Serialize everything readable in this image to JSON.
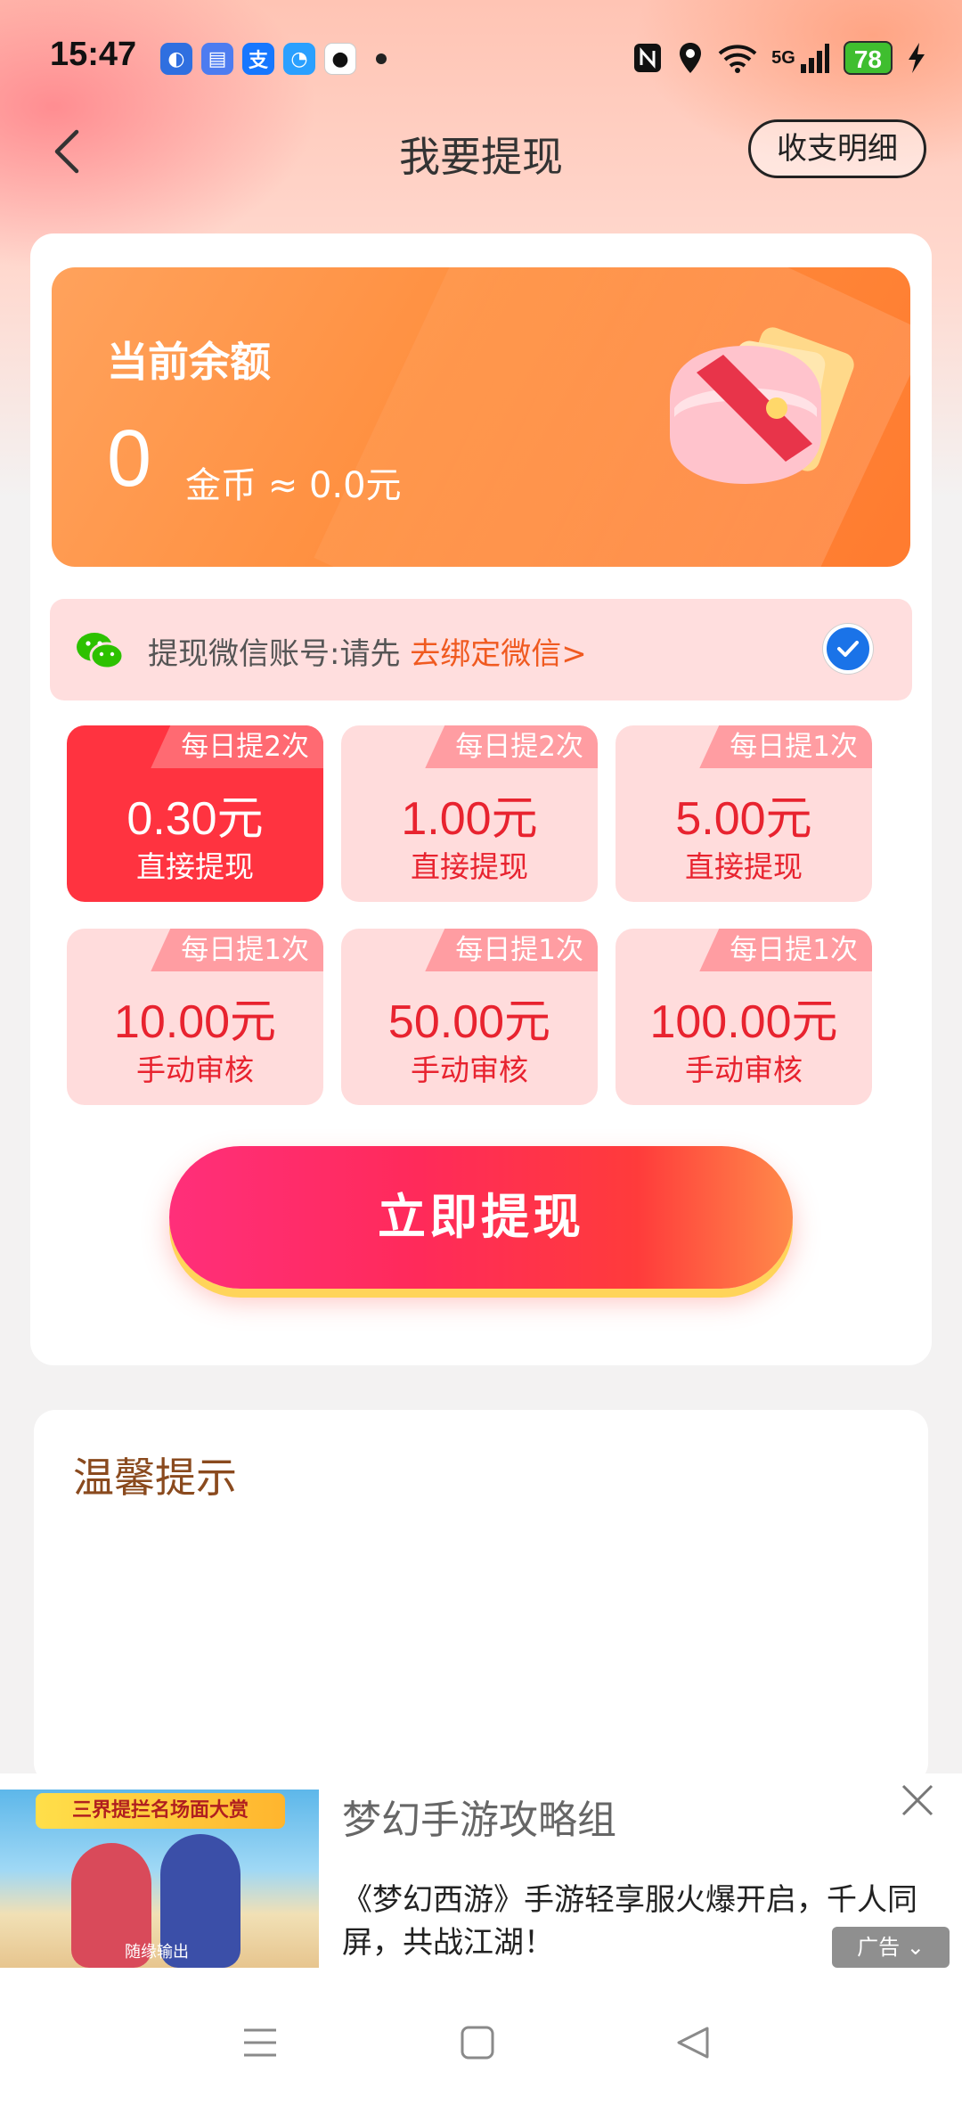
{
  "status_bar": {
    "time": "15:47",
    "network": "5G",
    "battery": "78",
    "notification_icons": [
      "app-blue-icon",
      "message-icon",
      "alipay-icon",
      "browser-icon",
      "qq-icon"
    ],
    "system_icons": [
      "nfc-icon",
      "location-icon",
      "wifi-icon",
      "signal-icon",
      "battery-icon",
      "charging-icon"
    ]
  },
  "header": {
    "title": "我要提现",
    "details_button": "收支明细"
  },
  "balance": {
    "label": "当前余额",
    "value": "0",
    "unit_text": "金币 ≈ 0.0元"
  },
  "wechat": {
    "prefix": "提现微信账号:请先",
    "link": "去绑定微信>"
  },
  "options": [
    {
      "tag": "每日提2次",
      "amount": "0.30元",
      "desc": "直接提现",
      "selected": true
    },
    {
      "tag": "每日提2次",
      "amount": "1.00元",
      "desc": "直接提现",
      "selected": false
    },
    {
      "tag": "每日提1次",
      "amount": "5.00元",
      "desc": "直接提现",
      "selected": false
    },
    {
      "tag": "每日提1次",
      "amount": "10.00元",
      "desc": "手动审核",
      "selected": false
    },
    {
      "tag": "每日提1次",
      "amount": "50.00元",
      "desc": "手动审核",
      "selected": false
    },
    {
      "tag": "每日提1次",
      "amount": "100.00元",
      "desc": "手动审核",
      "selected": false
    }
  ],
  "withdraw_button": "立即提现",
  "tips": {
    "title": "温馨提示"
  },
  "ad": {
    "image_banner": "三界提拦名场面大赏",
    "image_caption": "随缘输出",
    "title": "梦幻手游攻略组",
    "body": "《梦幻西游》手游轻享服火爆开启，千人同屏，共战江湖！",
    "badge": "广告"
  },
  "colors": {
    "accent_red": "#ff3340",
    "balance_orange": "#ff8f3f",
    "link_orange": "#f05a20",
    "tips_brown": "#8a4a1e"
  }
}
